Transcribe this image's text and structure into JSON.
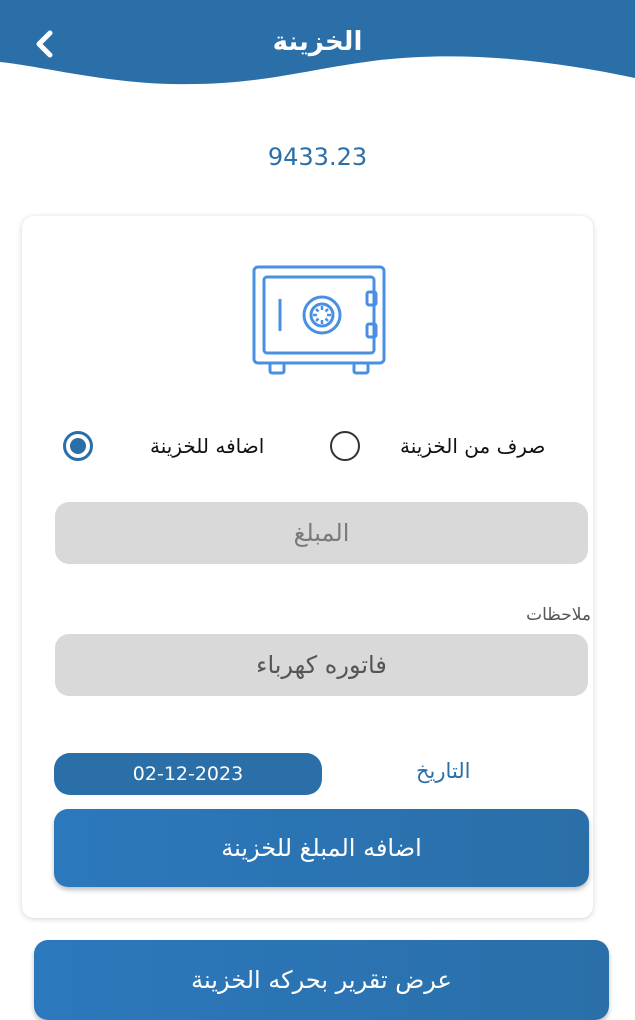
{
  "header": {
    "title": "الخزينة",
    "back_icon": "chevron-left-icon",
    "color": "#2a6fa8"
  },
  "balance": "9433.23",
  "card": {
    "safe_icon": "safe-icon",
    "radio": {
      "withdraw_label": "صرف من الخزينة",
      "withdraw_selected": false,
      "add_label": "اضافه للخزينة",
      "add_selected": true
    },
    "amount": {
      "value": "",
      "placeholder": "المبلغ"
    },
    "notes": {
      "label": "ملاحظات",
      "value": "فاتوره كهرباء",
      "placeholder": ""
    },
    "date": {
      "label": "التاريخ",
      "value": "02-12-2023"
    },
    "submit_label": "اضافه المبلغ للخزينة"
  },
  "report_button_label": "عرض تقرير بحركه الخزينة",
  "colors": {
    "primary": "#2a6fa8",
    "field_bg": "#d9d9d9"
  }
}
